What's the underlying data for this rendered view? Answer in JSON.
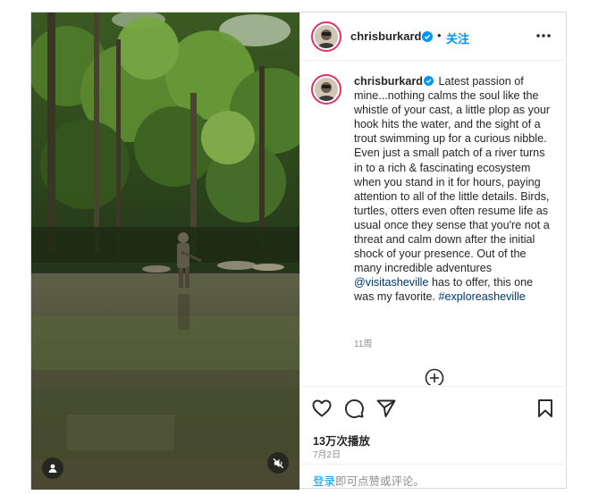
{
  "header": {
    "username": "chrisburkard",
    "separator": "•",
    "follow_label": "关注",
    "more_icon": "more-horizontal-icon"
  },
  "caption": {
    "username": "chrisburkard",
    "text_before_mention": "Latest passion of mine...nothing calms the soul like the whistle of your cast, a little plop as your hook hits the water, and the sight of a trout swimming up for a curious nibble. Even just a small patch of a river turns in to a rich & fascinating ecosystem when you stand in it for hours, paying attention to all of the little details. Birds, turtles, otters even often resume life as usual once they sense that you're not a threat and calm down after the initial shock of your presence. Out of the many incredible adventures",
    "mention": "@visitasheville",
    "text_after_mention": "has to offer, this one was my favorite.",
    "hashtag": "#exploreasheville",
    "time_ago": "11周"
  },
  "actions": {
    "icons": [
      "heart-icon",
      "comment-icon",
      "share-icon",
      "bookmark-icon"
    ],
    "views": "13万次播放",
    "date": "7月2日"
  },
  "login_prompt": {
    "link_text": "登录",
    "rest_text": "即可点赞或评论。"
  },
  "media": {
    "icons": [
      "user-tag-icon",
      "mute-icon"
    ]
  },
  "colors": {
    "follow": "#0095f6",
    "link": "#00376b",
    "verified": "#0095f6",
    "story_ring": "#e1306c"
  }
}
